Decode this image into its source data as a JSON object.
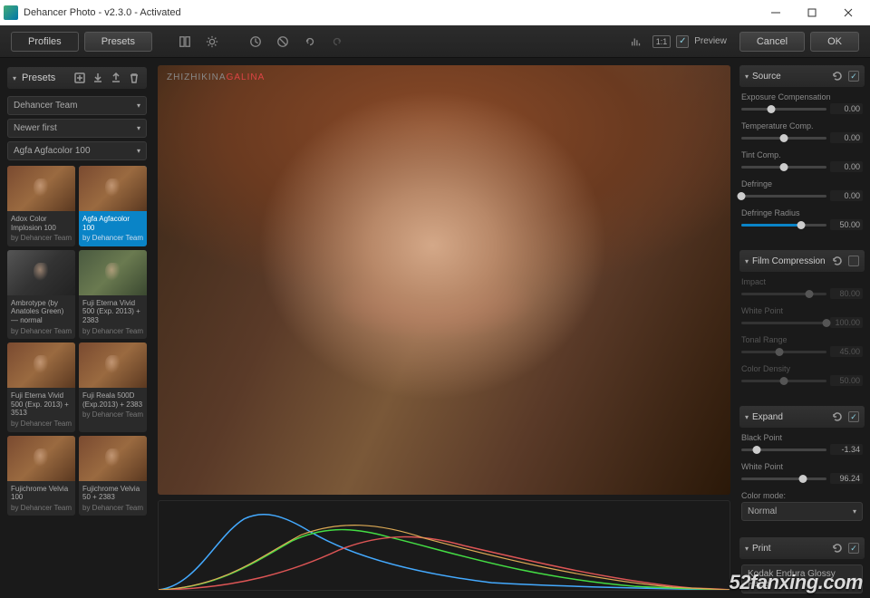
{
  "window": {
    "title": "Dehancer Photo - v2.3.0 - Activated"
  },
  "toolbar": {
    "profiles": "Profiles",
    "presets": "Presets",
    "preview_label": "Preview",
    "ratio": "1:1",
    "cancel": "Cancel",
    "ok": "OK"
  },
  "left": {
    "title": "Presets",
    "dropdowns": [
      {
        "label": "Dehancer Team"
      },
      {
        "label": "Newer first"
      },
      {
        "label": "Agfa Agfacolor 100"
      }
    ],
    "author_prefix": "by Dehancer Team",
    "presets": [
      {
        "name": "Adox Color Implosion 100",
        "thumb": "warm",
        "selected": false
      },
      {
        "name": "Agfa Agfacolor 100",
        "thumb": "warm",
        "selected": true
      },
      {
        "name": "Ambrotype (by Anatoles Green) — normal",
        "thumb": "bw",
        "selected": false
      },
      {
        "name": "Fuji Eterna Vivid 500 (Exp. 2013) + 2383",
        "thumb": "green",
        "selected": false
      },
      {
        "name": "Fuji Eterna Vivid 500 (Exp. 2013) + 3513",
        "thumb": "warm",
        "selected": false
      },
      {
        "name": "Fuji Reala 500D (Exp.2013) + 2383",
        "thumb": "warm",
        "selected": false
      },
      {
        "name": "Fujichrome Velvia 100",
        "thumb": "warm",
        "selected": false
      },
      {
        "name": "Fujichrome Velvia 50 + 2383",
        "thumb": "warm",
        "selected": false
      }
    ]
  },
  "center": {
    "watermark_a": "ZHIZHIKINA",
    "watermark_b": "GALINA"
  },
  "right": {
    "sections": [
      {
        "title": "Source",
        "enabled": true,
        "controls": [
          {
            "label": "Exposure Compensation",
            "value": "0.00",
            "pos": 35
          },
          {
            "label": "Temperature Comp.",
            "value": "0.00",
            "pos": 50
          },
          {
            "label": "Tint Comp.",
            "value": "0.00",
            "pos": 50
          },
          {
            "label": "Defringe",
            "value": "0.00",
            "pos": 0
          },
          {
            "label": "Defringe Radius",
            "value": "50.00",
            "pos": 70,
            "fill": 70
          }
        ]
      },
      {
        "title": "Film Compression",
        "enabled": false,
        "controls": [
          {
            "label": "Impact",
            "value": "80.00",
            "pos": 80
          },
          {
            "label": "White Point",
            "value": "100.00",
            "pos": 100
          },
          {
            "label": "Tonal Range",
            "value": "45.00",
            "pos": 45
          },
          {
            "label": "Color Density",
            "value": "50.00",
            "pos": 50
          }
        ]
      },
      {
        "title": "Expand",
        "enabled": true,
        "controls": [
          {
            "label": "Black Point",
            "value": "-1.34",
            "pos": 18
          },
          {
            "label": "White Point",
            "value": "96.24",
            "pos": 72
          }
        ],
        "color_mode_label": "Color mode:",
        "color_mode_value": "Normal"
      },
      {
        "title": "Print",
        "enabled": true,
        "dropdown": "Kodak Endura Glossy Paper"
      }
    ]
  },
  "watermark": "52fanxing.com"
}
